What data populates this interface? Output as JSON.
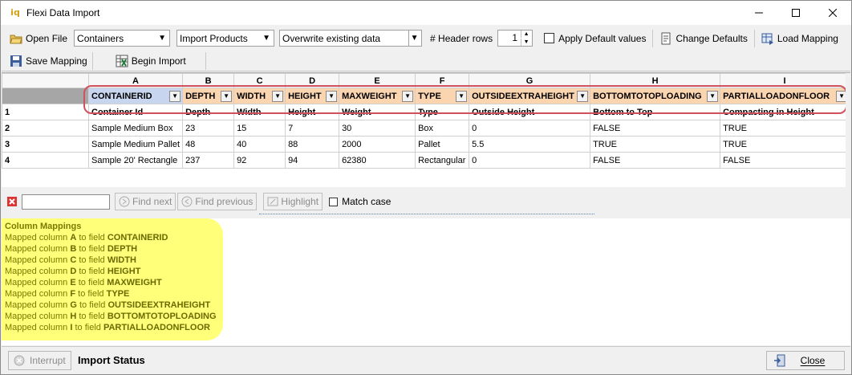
{
  "window": {
    "title": "Flexi Data Import",
    "icon": "iq"
  },
  "toolbar": {
    "open_file": "Open File",
    "combo_source": "Containers",
    "combo_action": "Import Products",
    "combo_mode": "Overwrite existing data",
    "header_rows_label": "# Header rows",
    "header_rows_value": "1",
    "apply_defaults": "Apply Default values",
    "change_defaults": "Change Defaults",
    "load_mapping": "Load Mapping",
    "save_mapping": "Save Mapping",
    "begin_import": "Begin Import"
  },
  "grid": {
    "column_letters": [
      "A",
      "B",
      "C",
      "D",
      "E",
      "F",
      "G",
      "H",
      "I"
    ],
    "mappings": [
      "CONTAINERID",
      "DEPTH",
      "WIDTH",
      "HEIGHT",
      "MAXWEIGHT",
      "TYPE",
      "OUTSIDEEXTRAHEIGHT",
      "BOTTOMTOTOPLOADING",
      "PARTIALLOADONFLOOR"
    ],
    "rows": [
      {
        "num": "1",
        "cells": [
          "Container Id",
          "Depth",
          "Width",
          "Height",
          "Weight",
          "Type",
          "Outside Height",
          "Bottom to Top",
          "Compacting in Height"
        ]
      },
      {
        "num": "2",
        "cells": [
          "Sample Medium Box",
          "23",
          "15",
          "7",
          "30",
          "Box",
          "0",
          "FALSE",
          "TRUE"
        ]
      },
      {
        "num": "3",
        "cells": [
          "Sample Medium Pallet",
          "48",
          "40",
          "88",
          "2000",
          "Pallet",
          "5.5",
          "TRUE",
          "TRUE"
        ]
      },
      {
        "num": "4",
        "cells": [
          "Sample 20' Rectangle",
          "237",
          "92",
          "94",
          "62380",
          "Rectangular",
          "0",
          "FALSE",
          "FALSE"
        ]
      }
    ]
  },
  "find": {
    "find_next": "Find next",
    "find_previous": "Find previous",
    "highlight": "Highlight",
    "match_case": "Match case"
  },
  "mappings_panel": {
    "title": "Column Mappings",
    "prefix": "Mapped column",
    "middle": "to field",
    "lines": [
      {
        "col": "A",
        "field": "CONTAINERID"
      },
      {
        "col": "B",
        "field": "DEPTH"
      },
      {
        "col": "C",
        "field": "WIDTH"
      },
      {
        "col": "D",
        "field": "HEIGHT"
      },
      {
        "col": "E",
        "field": "MAXWEIGHT"
      },
      {
        "col": "F",
        "field": "TYPE"
      },
      {
        "col": "G",
        "field": "OUTSIDEEXTRAHEIGHT"
      },
      {
        "col": "H",
        "field": "BOTTOMTOTOPLOADING"
      },
      {
        "col": "I",
        "field": "PARTIALLOADONFLOOR"
      }
    ]
  },
  "status": {
    "interrupt": "Interrupt",
    "import_status": "Import Status",
    "close": "Close"
  }
}
